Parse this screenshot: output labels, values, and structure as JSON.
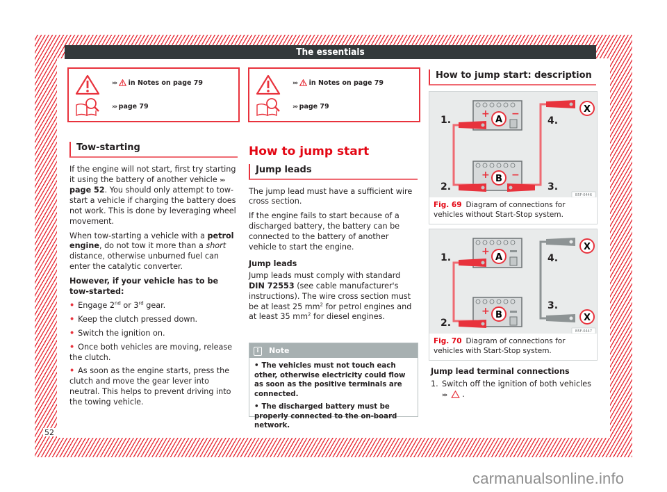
{
  "header": {
    "title": "The essentials"
  },
  "ref_boxes": [
    {
      "warning_ref": "in Notes on page 79",
      "page_ref": "page 79",
      "warning_icon": "warning-triangle-icon",
      "book_icon": "book-magnifier-icon"
    },
    {
      "warning_ref": "in Notes on page 79",
      "page_ref": "page 79",
      "warning_icon": "warning-triangle-icon",
      "book_icon": "book-magnifier-icon"
    }
  ],
  "col1": {
    "heading": "Tow-starting",
    "p1_a": "If the engine will not start, first try starting it using the battery of another vehicle ",
    "p1_link": "page 52",
    "p1_b": ". You should only attempt to tow-start a vehicle if charging the battery does not work. This is done by leveraging wheel movement.",
    "p2_a": "When tow-starting a vehicle with a ",
    "p2_bold": "petrol engine",
    "p2_b": ", do not tow it more than a ",
    "p2_italic": "short",
    "p2_c": " distance, otherwise unburned fuel can enter the catalytic converter.",
    "p3_bold": "However, if your vehicle has to be tow-started:",
    "bullet1_a": "Engage 2",
    "bullet1_sup1": "nd",
    "bullet1_b": " or 3",
    "bullet1_sup2": "rd",
    "bullet1_c": " gear.",
    "bullets": [
      "Keep the clutch pressed down.",
      "Switch the ignition on.",
      "Once both vehicles are moving, release the clutch.",
      "As soon as the engine starts, press the clutch and move the gear lever into neutral. This helps to prevent driving into the towing vehicle."
    ]
  },
  "col2": {
    "title": "How to jump start",
    "heading": "Jump leads",
    "p1": "The jump lead must have a sufficient wire cross section.",
    "p2": "If the engine fails to start because of a discharged battery, the battery can be connected to the battery of another vehicle to start the engine.",
    "sub_heading": "Jump leads",
    "p3_a": "Jump leads must comply with standard ",
    "p3_bold": "DIN 72553",
    "p3_b": " (see cable manufacturer's instructions). The wire cross section must be at least 25 mm",
    "p3_sup": "2",
    "p3_c": " for petrol engines and at least 35 mm",
    "p3_sup2": "2",
    "p3_d": " for diesel engines.",
    "note": {
      "label": "Note",
      "icon": "info-icon",
      "items": [
        "The vehicles must not touch each other, otherwise electricity could flow as soon as the positive terminals are connected.",
        "The discharged battery must be properly connected to the on-board network."
      ]
    }
  },
  "col3": {
    "heading": "How to jump start: description",
    "fig69": {
      "number": "Fig. 69",
      "caption": "Diagram of connections for vehicles without Start-Stop system.",
      "code": "B5F-0446",
      "labels": {
        "n1": "1.",
        "n2": "2.",
        "n3": "3.",
        "n4": "4.",
        "battery_a": "A",
        "battery_b": "B",
        "x": "X",
        "plus": "+",
        "minus": "−"
      }
    },
    "fig70": {
      "number": "Fig. 70",
      "caption": "Diagram of connections for vehicles with Start-Stop system.",
      "code": "B5F-0447",
      "labels": {
        "n1": "1.",
        "n2": "2.",
        "n3": "3.",
        "n4": "4.",
        "battery_a": "A",
        "battery_b": "B",
        "x": "X",
        "plus": "+",
        "minus": "−"
      }
    },
    "sub_heading": "Jump lead terminal connections",
    "step_number": "1.",
    "step_text": "Switch off the ignition of both vehicles",
    "step_suffix": "."
  },
  "page_number": "52",
  "watermark": "carmanualsonline.info",
  "colors": {
    "accent_red": "#e8323c",
    "header_bg": "#33393b",
    "note_header": "#a7b0b1"
  }
}
